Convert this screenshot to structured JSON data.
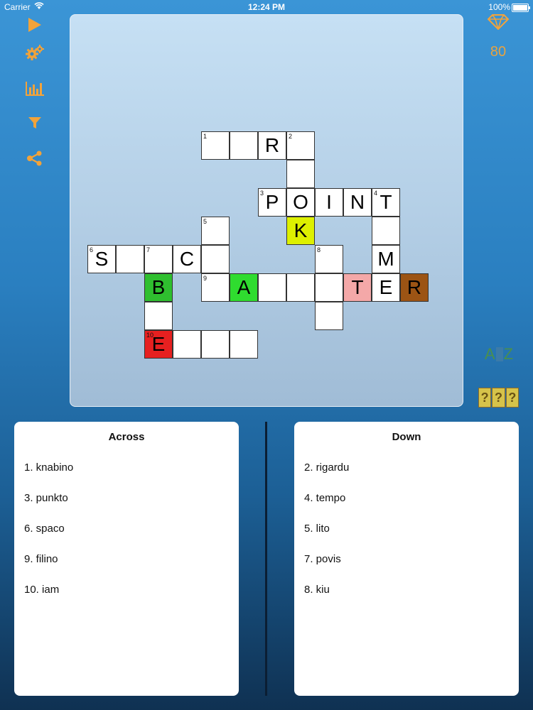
{
  "status_bar": {
    "carrier": "Carrier",
    "time": "12:24 PM",
    "battery": "100%"
  },
  "toolbar": {
    "items": [
      {
        "icon": "play-icon"
      },
      {
        "icon": "gears-icon"
      },
      {
        "icon": "bar-chart-icon"
      },
      {
        "icon": "filter-icon"
      },
      {
        "icon": "share-icon"
      }
    ]
  },
  "gems": {
    "icon": "diamond-icon",
    "count": "80"
  },
  "hints": {
    "az_left": "A",
    "az_right": "Z",
    "reveal": [
      "?",
      "?",
      "?"
    ]
  },
  "colors": {
    "accent": "#f2a33a",
    "green": "#2fbf2f",
    "lime": "#ddf000",
    "red": "#e62020",
    "pink": "#f4a8a8",
    "brown": "#9c5414"
  },
  "grid": {
    "cells": [
      {
        "c": 4,
        "r": 0,
        "num": "1",
        "letter": ""
      },
      {
        "c": 5,
        "r": 0,
        "num": "",
        "letter": ""
      },
      {
        "c": 6,
        "r": 0,
        "num": "",
        "letter": "R"
      },
      {
        "c": 7,
        "r": 0,
        "num": "2",
        "letter": ""
      },
      {
        "c": 7,
        "r": 1,
        "num": "",
        "letter": ""
      },
      {
        "c": 6,
        "r": 2,
        "num": "3",
        "letter": "P"
      },
      {
        "c": 7,
        "r": 2,
        "num": "",
        "letter": "O"
      },
      {
        "c": 8,
        "r": 2,
        "num": "",
        "letter": "I"
      },
      {
        "c": 9,
        "r": 2,
        "num": "",
        "letter": "N"
      },
      {
        "c": 10,
        "r": 2,
        "num": "4",
        "letter": "T"
      },
      {
        "c": 4,
        "r": 3,
        "num": "5",
        "letter": ""
      },
      {
        "c": 7,
        "r": 3,
        "num": "",
        "letter": "K",
        "bg": "#ddf000"
      },
      {
        "c": 10,
        "r": 3,
        "num": "",
        "letter": ""
      },
      {
        "c": 0,
        "r": 4,
        "num": "6",
        "letter": "S"
      },
      {
        "c": 1,
        "r": 4,
        "num": "",
        "letter": ""
      },
      {
        "c": 2,
        "r": 4,
        "num": "7",
        "letter": ""
      },
      {
        "c": 3,
        "r": 4,
        "num": "",
        "letter": "C"
      },
      {
        "c": 4,
        "r": 4,
        "num": "",
        "letter": ""
      },
      {
        "c": 8,
        "r": 4,
        "num": "8",
        "letter": ""
      },
      {
        "c": 10,
        "r": 4,
        "num": "",
        "letter": "M"
      },
      {
        "c": 2,
        "r": 5,
        "num": "",
        "letter": "B",
        "bg": "#2fbf2f"
      },
      {
        "c": 4,
        "r": 5,
        "num": "9",
        "letter": ""
      },
      {
        "c": 5,
        "r": 5,
        "num": "",
        "letter": "A",
        "bg": "#2fdc2f"
      },
      {
        "c": 6,
        "r": 5,
        "num": "",
        "letter": ""
      },
      {
        "c": 7,
        "r": 5,
        "num": "",
        "letter": ""
      },
      {
        "c": 8,
        "r": 5,
        "num": "",
        "letter": ""
      },
      {
        "c": 9,
        "r": 5,
        "num": "",
        "letter": "T",
        "bg": "#f4a8a8"
      },
      {
        "c": 10,
        "r": 5,
        "num": "",
        "letter": "E"
      },
      {
        "c": 11,
        "r": 5,
        "num": "",
        "letter": "R",
        "bg": "#9c5414"
      },
      {
        "c": 2,
        "r": 6,
        "num": "",
        "letter": ""
      },
      {
        "c": 8,
        "r": 6,
        "num": "",
        "letter": ""
      },
      {
        "c": 2,
        "r": 7,
        "num": "10",
        "letter": "E",
        "bg": "#e62020"
      },
      {
        "c": 3,
        "r": 7,
        "num": "",
        "letter": ""
      },
      {
        "c": 4,
        "r": 7,
        "num": "",
        "letter": ""
      },
      {
        "c": 5,
        "r": 7,
        "num": "",
        "letter": ""
      }
    ]
  },
  "across": {
    "title": "Across",
    "clues": [
      "1. knabino",
      "3. punkto",
      "6. spaco",
      "9. filino",
      "10. iam"
    ]
  },
  "down": {
    "title": "Down",
    "clues": [
      "2. rigardu",
      "4. tempo",
      "5. lito",
      "7. povis",
      "8. kiu"
    ]
  }
}
